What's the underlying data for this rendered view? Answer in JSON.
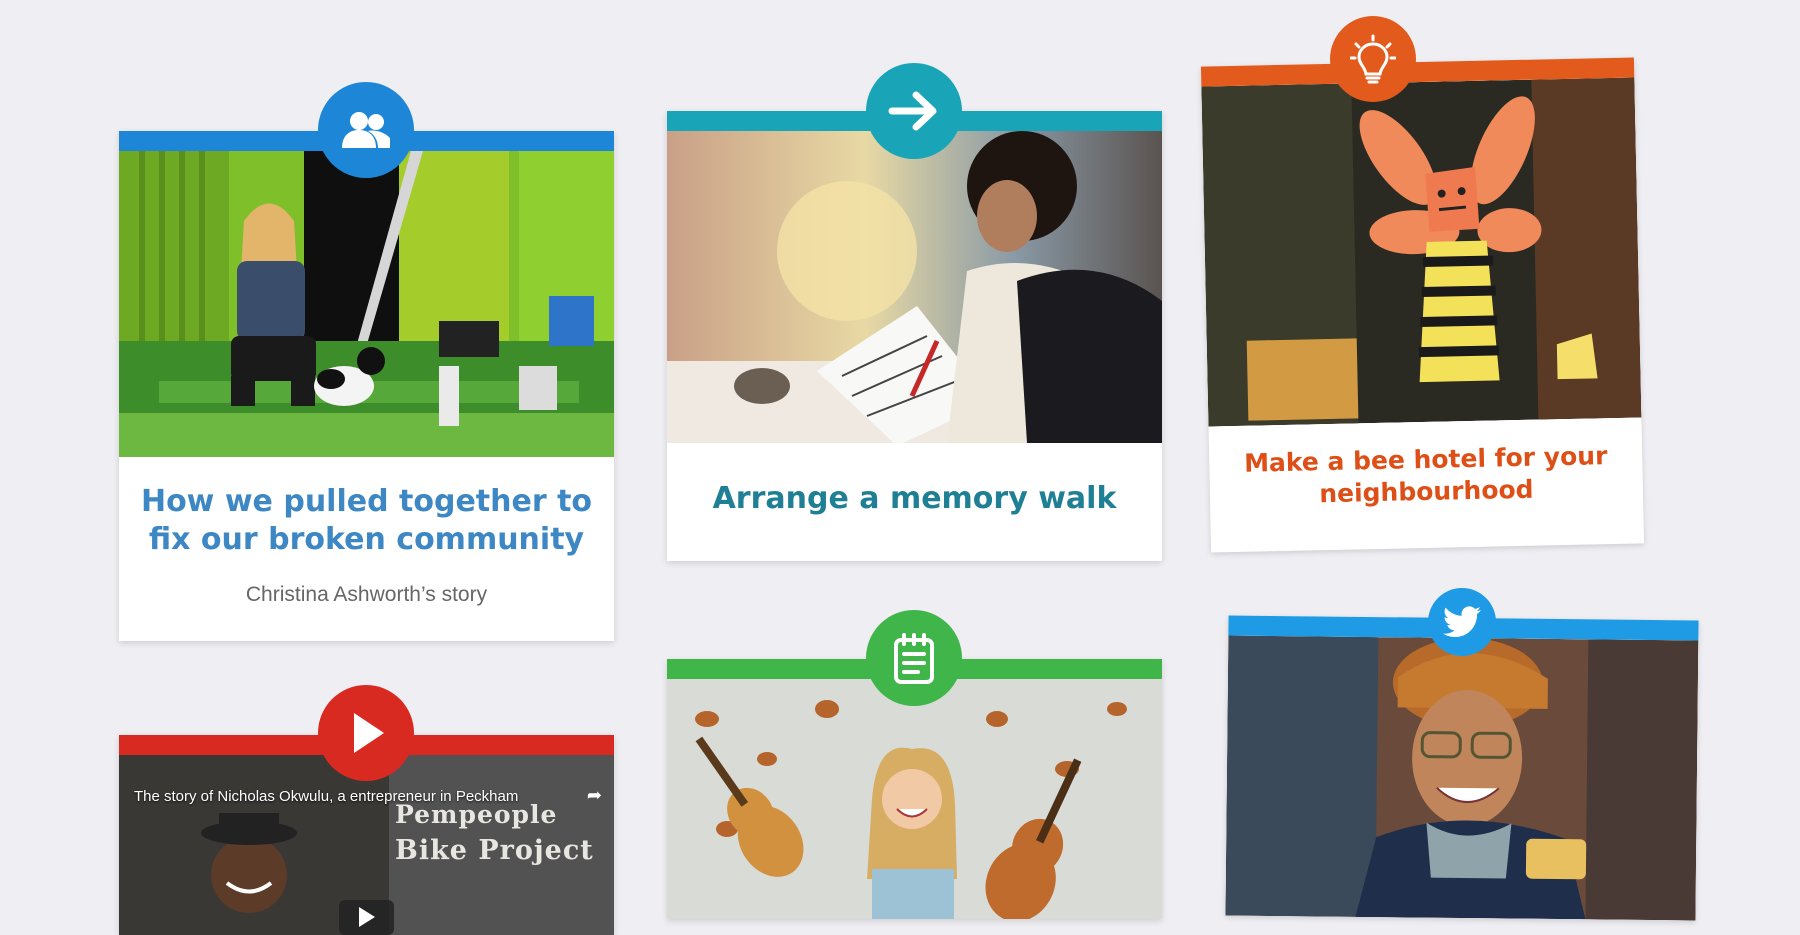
{
  "cards": [
    {
      "icon": "people-icon",
      "accent": "#1d86d6",
      "title": "How we pulled together to fix our broken community",
      "subtitle": "Christina Ashworth’s story"
    },
    {
      "icon": "arrow-right-icon",
      "accent": "#19a4b8",
      "title": "Arrange a memory walk"
    },
    {
      "icon": "lightbulb-icon",
      "accent": "#e25a1c",
      "title": "Make a bee hotel for your neighbourhood"
    },
    {
      "icon": "play-icon",
      "accent": "#d92a22",
      "video_title": "The story of Nicholas Okwulu, a entrepreneur in Peckham",
      "sign_line1": "Pempeople",
      "sign_line2": "Bike Project"
    },
    {
      "icon": "notepad-icon",
      "accent": "#3fb54a"
    },
    {
      "icon": "twitter-bird-icon",
      "accent": "#1e9be4"
    }
  ]
}
